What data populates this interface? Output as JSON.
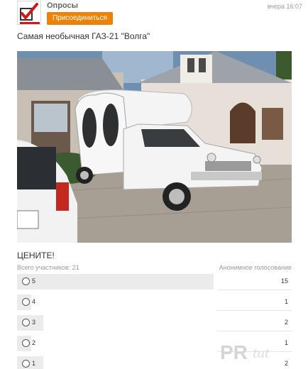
{
  "header": {
    "group_name": "Опросы",
    "join_label": "Присоединиться",
    "timestamp": "вчера 16:07",
    "avatar_icon": "poll-checkbox-icon"
  },
  "post": {
    "title": "Самая необычная ГАЗ-21 \"Волга\"",
    "photo_icon": "car-photo"
  },
  "poll": {
    "heading": "ЦЕНИТЕ!",
    "participants_label": "Всего участников: 21",
    "anonymous_label": "Анонимное голосование",
    "options": [
      {
        "label": "5",
        "votes": "15",
        "share": 0.714
      },
      {
        "label": "4",
        "votes": "1",
        "share": 0.048
      },
      {
        "label": "3",
        "votes": "2",
        "share": 0.095
      },
      {
        "label": "2",
        "votes": "1",
        "share": 0.048
      },
      {
        "label": "1",
        "votes": "2",
        "share": 0.095
      }
    ]
  },
  "colors": {
    "accent": "#ee8208",
    "bar": "#ebebeb"
  }
}
